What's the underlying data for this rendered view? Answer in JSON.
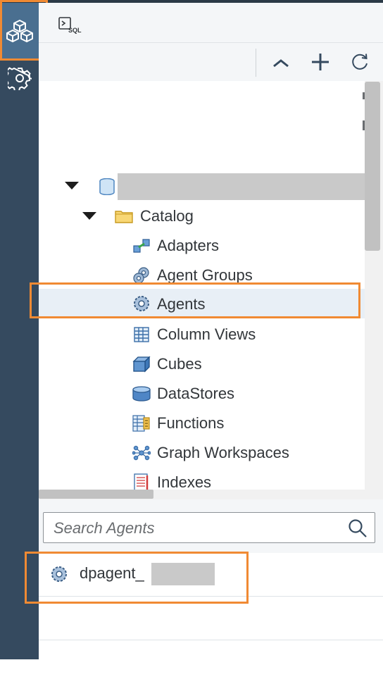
{
  "sidebar": {
    "items": [
      {
        "name": "database-explorer",
        "icon": "cubes-icon"
      },
      {
        "name": "settings",
        "icon": "gear-icon"
      }
    ]
  },
  "header": {
    "sql_icon_text": "SQL"
  },
  "toolbar": {
    "buttons": [
      {
        "name": "collapse",
        "icon": "chevron-up-icon"
      },
      {
        "name": "add",
        "icon": "plus-icon"
      },
      {
        "name": "refresh",
        "icon": "refresh-icon"
      }
    ]
  },
  "tree": {
    "root": {
      "label": "",
      "icon": "database-icon",
      "expanded": true
    },
    "catalog": {
      "label": "Catalog",
      "icon": "folder-icon",
      "expanded": true
    },
    "items": [
      {
        "label": "Adapters",
        "icon": "adapter-icon"
      },
      {
        "label": "Agent Groups",
        "icon": "agent-group-icon"
      },
      {
        "label": "Agents",
        "icon": "gear-icon",
        "selected": true
      },
      {
        "label": "Column Views",
        "icon": "column-view-icon"
      },
      {
        "label": "Cubes",
        "icon": "cube-icon"
      },
      {
        "label": "DataStores",
        "icon": "datastore-icon"
      },
      {
        "label": "Functions",
        "icon": "function-icon"
      },
      {
        "label": "Graph Workspaces",
        "icon": "graph-icon"
      },
      {
        "label": "Indexes",
        "icon": "index-icon"
      }
    ]
  },
  "search": {
    "placeholder": "Search Agents"
  },
  "results": [
    {
      "label": "dpagent_",
      "icon": "gear-icon"
    }
  ],
  "colors": {
    "sidebar": "#354a5f",
    "sidebar_active": "#4a6f90",
    "highlight": "#f08a33",
    "selected_row": "#e8eff6"
  }
}
